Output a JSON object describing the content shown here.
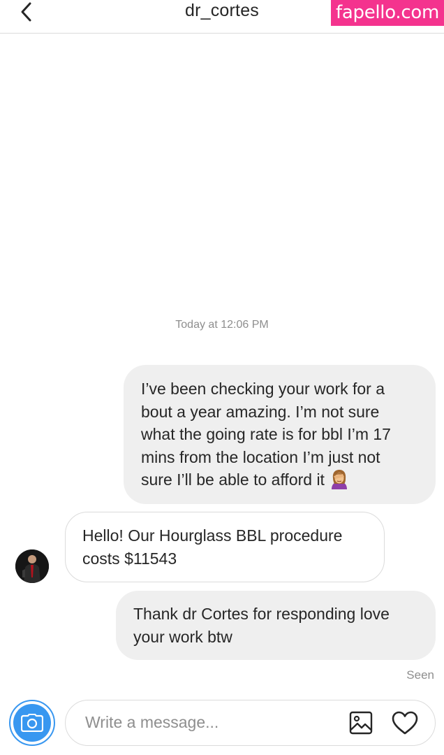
{
  "header": {
    "title": "dr_cortes",
    "back_icon": "chevron-left-icon"
  },
  "watermark": {
    "text": "fapello.com",
    "color": "#f4338e"
  },
  "thread": {
    "timestamp": "Today at 12:06 PM",
    "messages": [
      {
        "direction": "outgoing",
        "text": "I’ve been checking your work for a\nbout a year amazing. I’m not sure\nwhat the going rate is for bbl I’m 17\nmins from the location I’m just not\nsure I’ll be able to afford it",
        "emoji": "woman-facepalming-emoji"
      },
      {
        "direction": "incoming",
        "text": "Hello! Our Hourglass BBL procedure\ncosts $11543"
      },
      {
        "direction": "outgoing",
        "text": "Thank dr Cortes for responding love\nyour work btw"
      }
    ],
    "seen_label": "Seen"
  },
  "composer": {
    "placeholder": "Write a message...",
    "value": "",
    "camera_icon": "camera-icon",
    "gallery_icon": "image-gallery-icon",
    "heart_icon": "heart-icon"
  },
  "colors": {
    "accent": "#3897f0",
    "text": "#262626",
    "secondary_text": "#8e8e8e",
    "outgoing_bubble": "#efefef",
    "border": "#dbdbdb"
  }
}
